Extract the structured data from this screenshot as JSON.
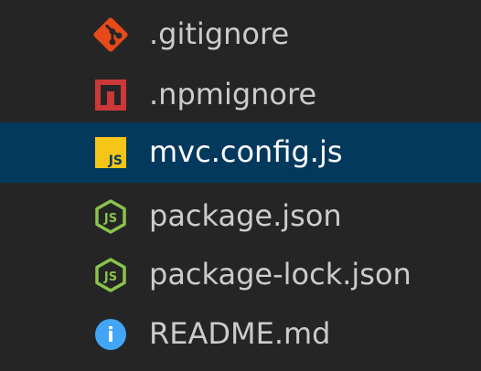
{
  "explorer": {
    "files": [
      {
        "label": ".gitignore",
        "icon": "git-icon",
        "color": "#e64a19",
        "selected": false
      },
      {
        "label": ".npmignore",
        "icon": "npm-icon",
        "color": "#cb3837",
        "selected": false
      },
      {
        "label": "mvc.config.js",
        "icon": "javascript-icon",
        "icon_text": "JS",
        "color": "#f5c518",
        "selected": true
      },
      {
        "label": "package.json",
        "icon": "nodejs-icon",
        "icon_text": "JS",
        "color": "#8bc34a",
        "selected": false
      },
      {
        "label": "package-lock.json",
        "icon": "nodejs-icon",
        "icon_text": "JS",
        "color": "#8bc34a",
        "selected": false
      },
      {
        "label": "README.md",
        "icon": "info-icon",
        "icon_text": "i",
        "color": "#42a5f5",
        "selected": false
      }
    ],
    "selection_color": "#04395e",
    "background_color": "#252526"
  }
}
